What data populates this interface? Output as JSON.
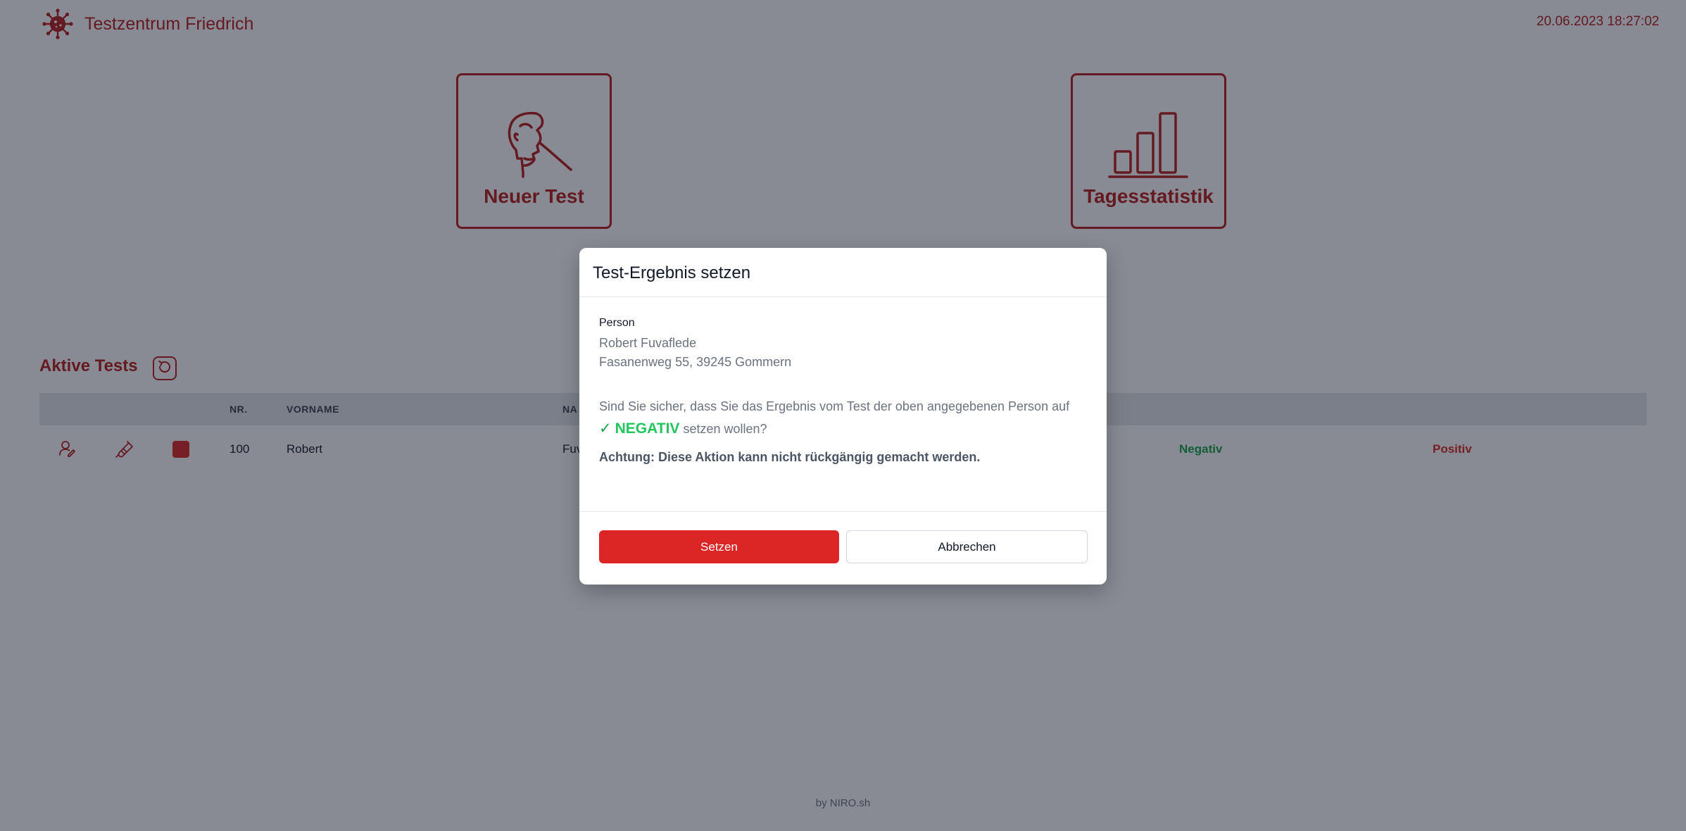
{
  "header": {
    "brand": "Testzentrum Friedrich",
    "datetime": "20.06.2023 18:27:02",
    "logo_icon": "virus-icon"
  },
  "tiles": {
    "new_test": {
      "label": "Neuer Test",
      "icon": "nasal-swab-icon"
    },
    "stats": {
      "label": "Tagesstatistik",
      "icon": "bar-chart-icon"
    }
  },
  "active_tests": {
    "title": "Aktive Tests",
    "refresh_icon": "refresh-icon",
    "columns": {
      "nr": "NR.",
      "vorname": "VORNAME",
      "nachname": "NA"
    },
    "rows": [
      {
        "nr": "100",
        "vorname": "Robert",
        "nachname_partial": "Fuv",
        "status_color": "#dc2626",
        "negativ": "Negativ",
        "positiv": "Positiv"
      }
    ]
  },
  "modal": {
    "title": "Test-Ergebnis setzen",
    "person_label": "Person",
    "person_name": "Robert Fuvaflede",
    "person_address": "Fasanenweg 55, 39245 Gommern",
    "question_part1": "Sind Sie sicher, dass Sie das Ergebnis vom Test der oben angegebenen Person auf",
    "result_check": "✓",
    "result_word": "NEGATIV",
    "question_part2": "setzen wollen?",
    "warning": "Achtung: Diese Aktion kann nicht rückgängig gemacht werden.",
    "confirm_label": "Setzen",
    "cancel_label": "Abbrechen"
  },
  "footer": {
    "text": "by NIRO.sh"
  },
  "colors": {
    "brand": "#b91c1c",
    "danger": "#dc2626",
    "success": "#16a34a",
    "overlay": "rgba(17,24,39,0.5)"
  }
}
